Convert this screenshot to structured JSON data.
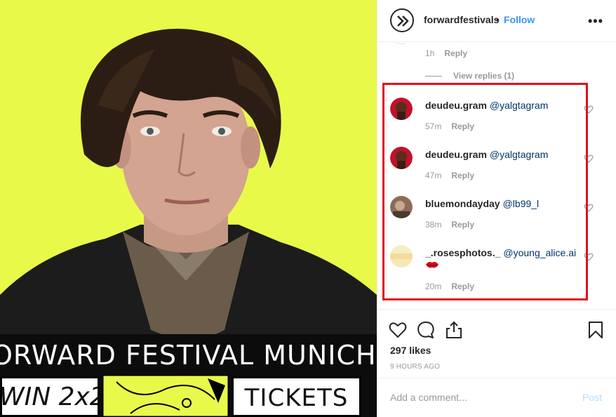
{
  "media": {
    "banner_title": "ORWARD FESTIVAL MUNICH",
    "win_text": "WIN 2x2",
    "tickets_text": "TICKETS"
  },
  "header": {
    "username": "forwardfestivals",
    "separator": "•",
    "follow_label": "Follow",
    "more_label": "•••"
  },
  "previous_comment": {
    "time": "1h",
    "reply_label": "Reply",
    "view_replies_label": "View replies (1)"
  },
  "comments": [
    {
      "username": "deudeu.gram",
      "mention": "@yalgtagram",
      "time": "57m",
      "reply_label": "Reply"
    },
    {
      "username": "deudeu.gram",
      "mention": "@yalgtagram",
      "time": "47m",
      "reply_label": "Reply"
    },
    {
      "username": "bluemondayday",
      "mention": "@lb99_l",
      "time": "38m",
      "reply_label": "Reply"
    },
    {
      "username": "_.rosesphotos._",
      "mention": "@young_alice.ai",
      "time": "20m",
      "reply_label": "Reply"
    }
  ],
  "actions": {
    "likes": "297 likes",
    "posted_time": "9 HOURS AGO"
  },
  "add_comment": {
    "placeholder": "Add a comment...",
    "post_label": "Post"
  },
  "colors": {
    "accent": "#3897f0",
    "highlight": "#e0111a",
    "media_background": "#e9f94a"
  },
  "icons": [
    "logo-icon",
    "more-icon",
    "heart-icon",
    "comment-icon",
    "share-icon",
    "bookmark-icon",
    "lips-emoji-icon"
  ]
}
